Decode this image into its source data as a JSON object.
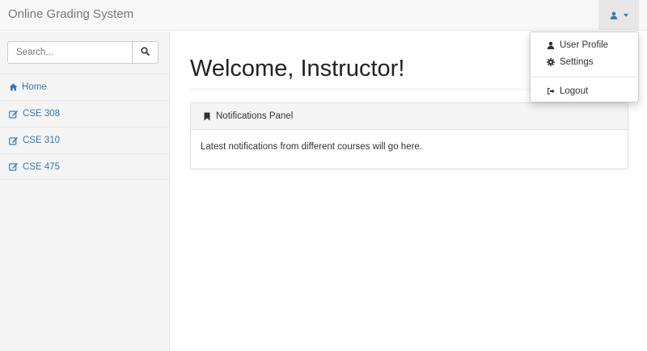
{
  "navbar": {
    "brand": "Online Grading System",
    "user_icon": "user-icon",
    "accent": "#337ab7"
  },
  "dropdown": {
    "items": [
      {
        "label": "User Profile",
        "icon": "user-icon"
      },
      {
        "label": "Settings",
        "icon": "gear-icon"
      },
      {
        "label": "Logout",
        "icon": "sign-out-icon"
      }
    ]
  },
  "sidebar": {
    "search": {
      "placeholder": "Search...",
      "value": "",
      "icon": "search-icon"
    },
    "items": [
      {
        "label": "Home",
        "icon": "home-icon"
      },
      {
        "label": "CSE 308",
        "icon": "edit-icon"
      },
      {
        "label": "CSE 310",
        "icon": "edit-icon"
      },
      {
        "label": "CSE 475",
        "icon": "edit-icon"
      }
    ]
  },
  "main": {
    "title": "Welcome, Instructor!",
    "panel": {
      "heading": "Notifications Panel",
      "icon": "bookmark-icon",
      "body": "Latest notifications from different courses will go here."
    }
  }
}
